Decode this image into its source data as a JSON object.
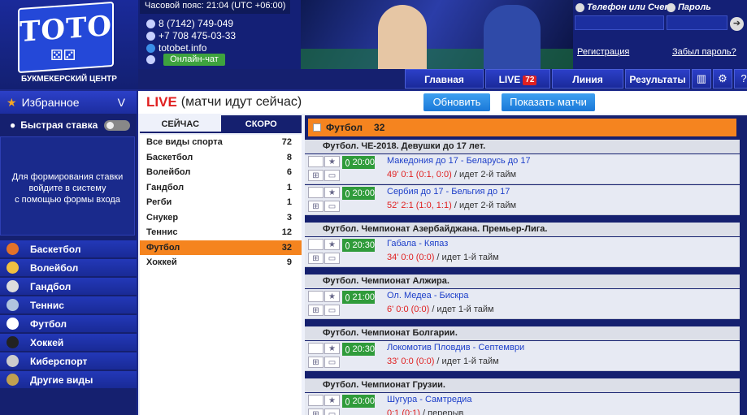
{
  "header": {
    "logo": "TOTO",
    "logo_sub": "БУКМЕКЕРСКИЙ ЦЕНТР",
    "timezone": "Часовой пояс: 21:04 (UTC +06:00)",
    "phone1": "8 (7142) 749-049",
    "phone2": "+7 708 475-03-33",
    "website": "totobet.info",
    "chat_label": "Онлайн-чат",
    "login_label": "Телефон или Счет",
    "password_label": "Пароль",
    "register_link": "Регистрация",
    "forgot_link": "Забыл пароль?"
  },
  "nav": {
    "main": "Главная",
    "live": "LIVE",
    "live_count": "72",
    "line": "Линия",
    "results": "Результаты"
  },
  "sidebar": {
    "favorites": "Избранное",
    "favorites_chevron": "V",
    "quick_bet": "Быстрая ставка",
    "login_message": [
      "Для формирования ставки",
      "войдите в систему",
      "с помощью формы входа"
    ],
    "sports": [
      {
        "label": "Баскетбол",
        "icon": "basketball-icon",
        "color": "#e2722a"
      },
      {
        "label": "Волейбол",
        "icon": "volleyball-icon",
        "color": "#f0c040"
      },
      {
        "label": "Гандбол",
        "icon": "handball-icon",
        "color": "#dddddd"
      },
      {
        "label": "Теннис",
        "icon": "tennis-icon",
        "color": "#b0c4de"
      },
      {
        "label": "Футбол",
        "icon": "football-icon",
        "color": "#ffffff"
      },
      {
        "label": "Хоккей",
        "icon": "hockey-icon",
        "color": "#222222"
      },
      {
        "label": "Киберспорт",
        "icon": "gamepad-icon",
        "color": "#cccccc"
      },
      {
        "label": "Другие виды",
        "icon": "trophy-icon",
        "color": "#c0a050"
      }
    ]
  },
  "live": {
    "title": "LIVE",
    "subtitle": "(матчи идут сейчас)",
    "refresh": "Обновить",
    "show_matches": "Показать матчи"
  },
  "tabs": {
    "now": "СЕЙЧАС",
    "soon": "СКОРО"
  },
  "sport_list": [
    {
      "name": "Все виды спорта",
      "count": "72"
    },
    {
      "name": "Баскетбол",
      "count": "8"
    },
    {
      "name": "Волейбол",
      "count": "6"
    },
    {
      "name": "Гандбол",
      "count": "1"
    },
    {
      "name": "Регби",
      "count": "1"
    },
    {
      "name": "Снукер",
      "count": "3"
    },
    {
      "name": "Теннис",
      "count": "12"
    },
    {
      "name": "Футбол",
      "count": "32"
    },
    {
      "name": "Хоккей",
      "count": "9"
    }
  ],
  "games": {
    "sport": "Футбол",
    "count": "32",
    "leagues": [
      {
        "name": "Футбол. ЧЕ-2018. Девушки до 17 лет.",
        "matches": [
          {
            "time": "20:00",
            "teams": "Македония до 17 - Беларусь до 17",
            "score": "49' 0:1 (0:1, 0:0)",
            "status": "/ идет 2-й тайм"
          },
          {
            "time": "20:00",
            "teams": "Сербия до 17 - Бельгия до 17",
            "score": "52' 2:1 (1:0, 1:1)",
            "status": "/ идет 2-й тайм"
          }
        ]
      },
      {
        "name": "Футбол. Чемпионат Азербайджана. Премьер-Лига.",
        "matches": [
          {
            "time": "20:30",
            "teams": "Габала - Кяпаз",
            "score": "34' 0:0 (0:0)",
            "status": "/ идет 1-й тайм"
          }
        ]
      },
      {
        "name": "Футбол. Чемпионат Алжира.",
        "matches": [
          {
            "time": "21:00",
            "teams": "Ол. Медеа - Бискра",
            "score": "6' 0:0 (0:0)",
            "status": "/ идет 1-й тайм"
          }
        ]
      },
      {
        "name": "Футбол. Чемпионат Болгарии.",
        "matches": [
          {
            "time": "20:30",
            "teams": "Локомотив Пловдив - Септември",
            "score": "33' 0:0 (0:0)",
            "status": "/ идет 1-й тайм"
          }
        ]
      },
      {
        "name": "Футбол. Чемпионат Грузии.",
        "matches": [
          {
            "time": "20:00",
            "teams": "Шугура - Самтредиа",
            "score": "0:1 (0:1)",
            "status": "/ перерыв"
          }
        ]
      }
    ]
  }
}
